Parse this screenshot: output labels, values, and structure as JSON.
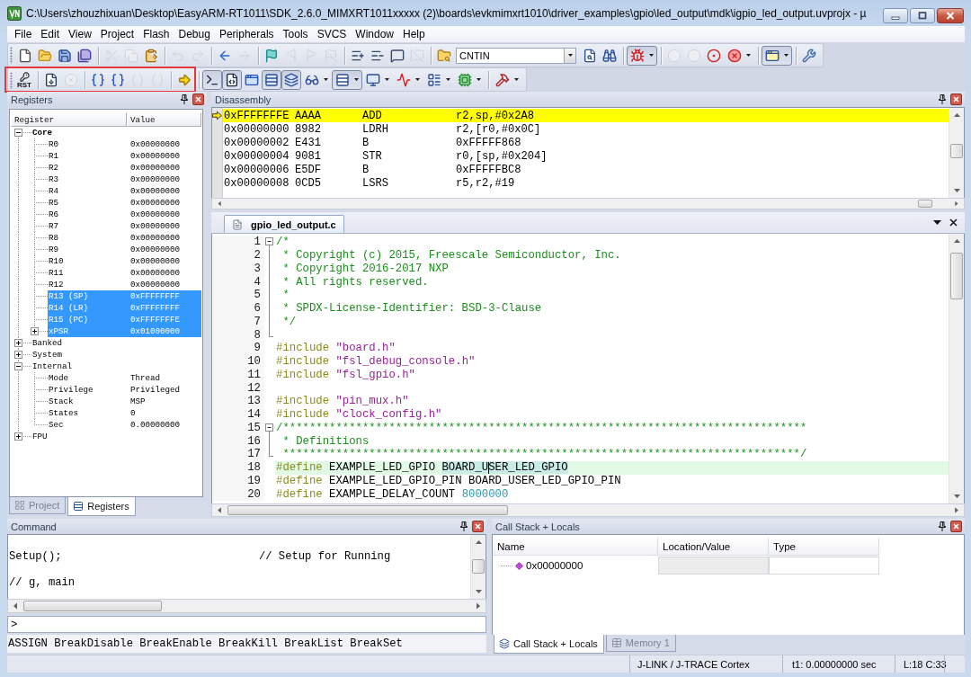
{
  "window": {
    "title": "C:\\Users\\zhouzhixuan\\Desktop\\EasyARM-RT1011\\SDK_2.6.0_MIMXRT1011xxxxx (2)\\boards\\evkmimxrt1010\\driver_examples\\gpio\\led_output\\mdk\\igpio_led_output.uvprojx - µ"
  },
  "menu": [
    "File",
    "Edit",
    "View",
    "Project",
    "Flash",
    "Debug",
    "Peripherals",
    "Tools",
    "SVCS",
    "Window",
    "Help"
  ],
  "toolbar_1": {
    "groups_before": [
      [
        {
          "kind": "new",
          "disabled": false,
          "pressed": false,
          "dropdown": false
        },
        {
          "kind": "open",
          "disabled": false,
          "pressed": false,
          "dropdown": false
        },
        {
          "kind": "save",
          "disabled": false,
          "pressed": false,
          "dropdown": false
        },
        {
          "kind": "saveall",
          "disabled": false,
          "pressed": false,
          "dropdown": false
        }
      ],
      [
        {
          "kind": "cut",
          "disabled": true,
          "pressed": false,
          "dropdown": false
        },
        {
          "kind": "copy",
          "disabled": true,
          "pressed": false,
          "dropdown": false
        },
        {
          "kind": "paste",
          "disabled": false,
          "pressed": false,
          "dropdown": false
        }
      ],
      [
        {
          "kind": "undo",
          "disabled": true,
          "pressed": false,
          "dropdown": false
        },
        {
          "kind": "redo",
          "disabled": true,
          "pressed": false,
          "dropdown": false
        }
      ],
      [
        {
          "kind": "back",
          "disabled": false,
          "pressed": false,
          "dropdown": false
        },
        {
          "kind": "forward",
          "disabled": true,
          "pressed": false,
          "dropdown": false
        }
      ],
      [
        {
          "kind": "bookmark",
          "disabled": false,
          "pressed": false,
          "dropdown": false
        },
        {
          "kind": "prevmark",
          "disabled": true,
          "pressed": false,
          "dropdown": false
        },
        {
          "kind": "nextmark",
          "disabled": true,
          "pressed": false,
          "dropdown": false
        },
        {
          "kind": "clearmarks",
          "disabled": true,
          "pressed": false,
          "dropdown": false
        }
      ],
      [
        {
          "kind": "indent",
          "disabled": false,
          "pressed": false,
          "dropdown": false
        },
        {
          "kind": "unindent",
          "disabled": false,
          "pressed": false,
          "dropdown": false
        },
        {
          "kind": "comment",
          "disabled": false,
          "pressed": false,
          "dropdown": false
        },
        {
          "kind": "uncomment",
          "disabled": true,
          "pressed": false,
          "dropdown": false
        }
      ],
      [
        {
          "kind": "findfiles",
          "disabled": false,
          "pressed": false,
          "dropdown": false
        }
      ]
    ],
    "target": {
      "value": "CNTIN"
    },
    "groups_after": [
      [
        {
          "kind": "find",
          "disabled": false,
          "pressed": false,
          "dropdown": false
        },
        {
          "kind": "incfind",
          "disabled": false,
          "pressed": false,
          "dropdown": false
        }
      ],
      [
        {
          "kind": "debug",
          "disabled": false,
          "pressed": true,
          "dropdown": true
        }
      ],
      [
        {
          "kind": "bpinsert",
          "disabled": true,
          "pressed": false,
          "dropdown": false
        },
        {
          "kind": "bpenable",
          "disabled": true,
          "pressed": false,
          "dropdown": false
        },
        {
          "kind": "bpdisable",
          "disabled": false,
          "pressed": false,
          "dropdown": false
        },
        {
          "kind": "bpkill",
          "disabled": false,
          "pressed": false,
          "dropdown": true
        }
      ],
      [
        {
          "kind": "layout",
          "disabled": false,
          "pressed": true,
          "dropdown": true
        }
      ],
      [
        {
          "kind": "configure",
          "disabled": false,
          "pressed": false,
          "dropdown": false
        }
      ]
    ]
  },
  "toolbar_2": {
    "sections": [
      {
        "highlighted": true,
        "groups": [
          [
            {
              "kind": "reset",
              "label": "RST",
              "disabled": false,
              "pressed": false,
              "dropdown": false
            }
          ],
          [
            {
              "kind": "run",
              "disabled": false,
              "pressed": false,
              "dropdown": false
            },
            {
              "kind": "stop",
              "disabled": true,
              "pressed": false,
              "dropdown": false
            }
          ],
          [
            {
              "kind": "stepinto",
              "disabled": false,
              "pressed": false,
              "dropdown": false
            },
            {
              "kind": "stepover",
              "disabled": false,
              "pressed": false,
              "dropdown": false
            },
            {
              "kind": "stepout",
              "disabled": true,
              "pressed": false,
              "dropdown": false
            },
            {
              "kind": "runcursor",
              "disabled": true,
              "pressed": false,
              "dropdown": false
            }
          ],
          [
            {
              "kind": "shownext",
              "disabled": false,
              "pressed": false,
              "dropdown": false
            }
          ]
        ]
      },
      {
        "highlighted": false,
        "groups": [
          [
            {
              "kind": "cmdwin",
              "disabled": false,
              "pressed": true,
              "dropdown": false
            },
            {
              "kind": "disasm",
              "disabled": false,
              "pressed": true,
              "dropdown": false
            },
            {
              "kind": "symbols",
              "disabled": false,
              "pressed": false,
              "dropdown": false
            },
            {
              "kind": "registers",
              "disabled": false,
              "pressed": true,
              "dropdown": false
            },
            {
              "kind": "callstack",
              "disabled": false,
              "pressed": true,
              "dropdown": false
            },
            {
              "kind": "watch",
              "disabled": false,
              "pressed": false,
              "dropdown": true
            },
            {
              "kind": "memory",
              "disabled": false,
              "pressed": true,
              "dropdown": true
            },
            {
              "kind": "serial",
              "disabled": false,
              "pressed": false,
              "dropdown": true
            },
            {
              "kind": "analysis",
              "disabled": false,
              "pressed": false,
              "dropdown": true
            },
            {
              "kind": "sysview",
              "disabled": false,
              "pressed": false,
              "dropdown": true
            },
            {
              "kind": "toolbox",
              "disabled": false,
              "pressed": false,
              "dropdown": true
            }
          ],
          [
            {
              "kind": "tools",
              "disabled": false,
              "pressed": false,
              "dropdown": true
            }
          ]
        ]
      }
    ]
  },
  "registers": {
    "title": "Registers",
    "columns": [
      "Register",
      "Value"
    ],
    "tree": [
      {
        "name": "Core",
        "kind": "folder",
        "expanded": true,
        "bold": true,
        "selected": false,
        "children": [
          {
            "name": "R0",
            "value": "0x00000000",
            "kind": "item",
            "selected": false
          },
          {
            "name": "R1",
            "value": "0x00000000",
            "kind": "item",
            "selected": false
          },
          {
            "name": "R2",
            "value": "0x00000000",
            "kind": "item",
            "selected": false
          },
          {
            "name": "R3",
            "value": "0x00000000",
            "kind": "item",
            "selected": false
          },
          {
            "name": "R4",
            "value": "0x00000000",
            "kind": "item",
            "selected": false
          },
          {
            "name": "R5",
            "value": "0x00000000",
            "kind": "item",
            "selected": false
          },
          {
            "name": "R6",
            "value": "0x00000000",
            "kind": "item",
            "selected": false
          },
          {
            "name": "R7",
            "value": "0x00000000",
            "kind": "item",
            "selected": false
          },
          {
            "name": "R8",
            "value": "0x00000000",
            "kind": "item",
            "selected": false
          },
          {
            "name": "R9",
            "value": "0x00000000",
            "kind": "item",
            "selected": false
          },
          {
            "name": "R10",
            "value": "0x00000000",
            "kind": "item",
            "selected": false
          },
          {
            "name": "R11",
            "value": "0x00000000",
            "kind": "item",
            "selected": false
          },
          {
            "name": "R12",
            "value": "0x00000000",
            "kind": "item",
            "selected": false
          },
          {
            "name": "R13 (SP)",
            "value": "0xFFFFFFFF",
            "kind": "item",
            "selected": true
          },
          {
            "name": "R14 (LR)",
            "value": "0xFFFFFFFF",
            "kind": "item",
            "selected": true
          },
          {
            "name": "R15 (PC)",
            "value": "0xFFFFFFFE",
            "kind": "item",
            "selected": true
          },
          {
            "name": "xPSR",
            "value": "0x01000000",
            "kind": "folder",
            "expanded": false,
            "selected": true
          }
        ]
      },
      {
        "name": "Banked",
        "kind": "folder",
        "expanded": false,
        "bold": false,
        "selected": false
      },
      {
        "name": "System",
        "kind": "folder",
        "expanded": false,
        "bold": false,
        "selected": false
      },
      {
        "name": "Internal",
        "kind": "folder",
        "expanded": true,
        "bold": false,
        "selected": false,
        "children": [
          {
            "name": "Mode",
            "value": "Thread",
            "kind": "item",
            "selected": false
          },
          {
            "name": "Privilege",
            "value": "Privileged",
            "kind": "item",
            "selected": false
          },
          {
            "name": "Stack",
            "value": "MSP",
            "kind": "item",
            "selected": false
          },
          {
            "name": "States",
            "value": "0",
            "kind": "item",
            "selected": false
          },
          {
            "name": "Sec",
            "value": "0.00000000",
            "kind": "item",
            "selected": false
          }
        ]
      },
      {
        "name": "FPU",
        "kind": "folder",
        "expanded": false,
        "bold": false,
        "selected": false
      }
    ],
    "tabs": [
      {
        "label": "Project",
        "kind": "project",
        "selected": false
      },
      {
        "label": "Registers",
        "kind": "registers",
        "selected": true
      }
    ]
  },
  "disassembly": {
    "title": "Disassembly",
    "rows": [
      {
        "address": "0xFFFFFFFE",
        "opcode": "AAAA",
        "mnemonic": "ADD",
        "operands": "r2,sp,#0x2A8",
        "current": true
      },
      {
        "address": "0x00000000",
        "opcode": "8982",
        "mnemonic": "LDRH",
        "operands": "r2,[r0,#0x0C]",
        "current": false
      },
      {
        "address": "0x00000002",
        "opcode": "E431",
        "mnemonic": "B",
        "operands": "0xFFFFF868",
        "current": false
      },
      {
        "address": "0x00000004",
        "opcode": "9081",
        "mnemonic": "STR",
        "operands": "r0,[sp,#0x204]",
        "current": false
      },
      {
        "address": "0x00000006",
        "opcode": "E5DF",
        "mnemonic": "B",
        "operands": "0xFFFFFBC8",
        "current": false
      },
      {
        "address": "0x00000008",
        "opcode": "0CD5",
        "mnemonic": "LSRS",
        "operands": "r5,r2,#19",
        "current": false
      }
    ]
  },
  "editor": {
    "tabs": [
      {
        "label": "gpio_led_output.c",
        "selected": true
      }
    ],
    "lines": [
      {
        "number": "1",
        "kind": "foldstart",
        "highlighted": false,
        "tokens": [
          {
            "kind": "comment",
            "text": "/*"
          }
        ]
      },
      {
        "number": "2",
        "kind": "foldbody",
        "highlighted": false,
        "tokens": [
          {
            "kind": "comment",
            "text": " * Copyright (c) 2015, Freescale Semiconductor, Inc."
          }
        ]
      },
      {
        "number": "3",
        "kind": "foldbody",
        "highlighted": false,
        "tokens": [
          {
            "kind": "comment",
            "text": " * Copyright 2016-2017 NXP"
          }
        ]
      },
      {
        "number": "4",
        "kind": "foldbody",
        "highlighted": false,
        "tokens": [
          {
            "kind": "comment",
            "text": " * All rights reserved."
          }
        ]
      },
      {
        "number": "5",
        "kind": "foldbody",
        "highlighted": false,
        "tokens": [
          {
            "kind": "comment",
            "text": " *"
          }
        ]
      },
      {
        "number": "6",
        "kind": "foldbody",
        "highlighted": false,
        "tokens": [
          {
            "kind": "comment",
            "text": " * SPDX-License-Identifier: BSD-3-Clause"
          }
        ]
      },
      {
        "number": "7",
        "kind": "foldbody",
        "highlighted": false,
        "tokens": [
          {
            "kind": "comment",
            "text": " */"
          }
        ]
      },
      {
        "number": "8",
        "kind": "foldend",
        "highlighted": false
      },
      {
        "number": "9",
        "kind": "code",
        "highlighted": false,
        "tokens": [
          {
            "kind": "preprocessor",
            "text": "#include"
          },
          {
            "kind": "string",
            "text": " \"board.h\""
          }
        ]
      },
      {
        "number": "10",
        "kind": "code",
        "highlighted": false,
        "tokens": [
          {
            "kind": "preprocessor",
            "text": "#include"
          },
          {
            "kind": "string",
            "text": " \"fsl_debug_console.h\""
          }
        ]
      },
      {
        "number": "11",
        "kind": "code",
        "highlighted": false,
        "tokens": [
          {
            "kind": "preprocessor",
            "text": "#include"
          },
          {
            "kind": "string",
            "text": " \"fsl_gpio.h\""
          }
        ]
      },
      {
        "number": "12",
        "kind": "code",
        "highlighted": false
      },
      {
        "number": "13",
        "kind": "code",
        "highlighted": false,
        "tokens": [
          {
            "kind": "preprocessor",
            "text": "#include"
          },
          {
            "kind": "string",
            "text": " \"pin_mux.h\""
          }
        ]
      },
      {
        "number": "14",
        "kind": "code",
        "highlighted": false,
        "tokens": [
          {
            "kind": "preprocessor",
            "text": "#include"
          },
          {
            "kind": "string",
            "text": " \"clock_config.h\""
          }
        ]
      },
      {
        "number": "15",
        "kind": "foldstart",
        "highlighted": false,
        "tokens": [
          {
            "kind": "comment",
            "text": "/*******************************************************************************"
          }
        ]
      },
      {
        "number": "16",
        "kind": "foldbody",
        "highlighted": false,
        "tokens": [
          {
            "kind": "comment",
            "text": " * Definitions"
          }
        ]
      },
      {
        "number": "17",
        "kind": "foldend",
        "highlighted": false,
        "tokens": [
          {
            "kind": "comment",
            "text": " ******************************************************************************/"
          }
        ]
      },
      {
        "number": "18",
        "kind": "code",
        "highlighted": true,
        "tokens": [
          {
            "kind": "preprocessor",
            "text": "#define"
          },
          {
            "kind": "plain",
            "text": " EXAMPLE_LED_GPIO "
          },
          {
            "kind": "match",
            "text": "BOARD_U"
          },
          {
            "kind": "caret"
          },
          {
            "kind": "match",
            "text": "SER_LED_GPIO"
          }
        ]
      },
      {
        "number": "19",
        "kind": "code",
        "highlighted": false,
        "tokens": [
          {
            "kind": "preprocessor",
            "text": "#define"
          },
          {
            "kind": "plain",
            "text": " EXAMPLE_LED_GPIO_PIN BOARD_USER_LED_GPIO_PIN"
          }
        ]
      },
      {
        "number": "20",
        "kind": "code",
        "highlighted": false,
        "tokens": [
          {
            "kind": "preprocessor",
            "text": "#define"
          },
          {
            "kind": "plain",
            "text": " EXAMPLE_DELAY_COUNT "
          },
          {
            "kind": "number",
            "text": "8000000"
          }
        ]
      }
    ]
  },
  "command": {
    "title": "Command",
    "output": [
      "Setup();                              // Setup for Running",
      "// g, main"
    ],
    "prompt": ">",
    "hint": "ASSIGN BreakDisable BreakEnable BreakKill BreakList BreakSet"
  },
  "call_stack": {
    "title": "Call Stack + Locals",
    "columns": [
      "Name",
      "Location/Value",
      "Type"
    ],
    "rows": [
      {
        "name": "0x00000000"
      }
    ],
    "tabs": [
      {
        "label": "Call Stack + Locals",
        "kind": "callstack",
        "selected": true
      },
      {
        "label": "Memory 1",
        "kind": "memory",
        "selected": false
      }
    ]
  },
  "status_bar": [
    "J-LINK / J-TRACE Cortex",
    "t1: 0.00000000 sec",
    "L:18 C:33"
  ]
}
